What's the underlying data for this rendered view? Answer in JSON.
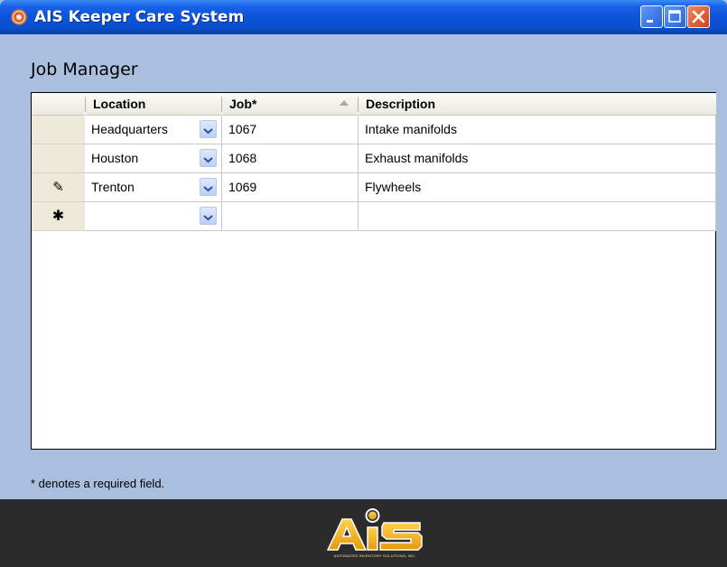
{
  "window": {
    "title": "AIS Keeper Care System",
    "buttons": [
      "minimize",
      "maximize",
      "close"
    ]
  },
  "page_title": "Job Manager",
  "grid": {
    "columns": [
      {
        "label": "Location"
      },
      {
        "label": "Job*"
      },
      {
        "label": "Description"
      }
    ],
    "rows": [
      {
        "indicator": "",
        "location": "Headquarters",
        "job": "1067",
        "description": "Intake manifolds"
      },
      {
        "indicator": "",
        "location": "Houston",
        "job": "1068",
        "description": "Exhaust manifolds"
      },
      {
        "indicator": "✎",
        "location": "Trenton",
        "job": "1069",
        "description": "Flywheels"
      },
      {
        "indicator": "✱",
        "location": "",
        "job": "",
        "description": ""
      }
    ]
  },
  "footer_note": "* denotes a required field.",
  "logo": {
    "text": "AiS",
    "subtitle": "AUTOMATED INVENTORY SOLUTIONS, INC.",
    "colors": {
      "gold": "#f2b21b",
      "dark": "#2b2b2b"
    }
  },
  "colors": {
    "titlebar": "#0a53d9",
    "client_background": "#aabfde",
    "header_background": "#ece9d8",
    "close_button": "#d2401a"
  },
  "icons": {
    "app": "ais-app-icon",
    "dropdown": "chevron-down-icon",
    "edit_row": "pencil-icon",
    "new_row": "asterisk-icon",
    "sort": "sort-ascending-icon"
  }
}
